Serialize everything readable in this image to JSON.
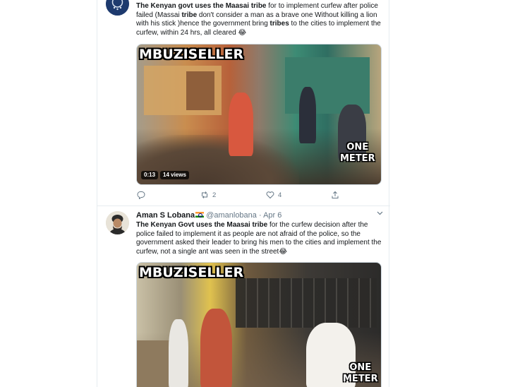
{
  "tweets": [
    {
      "text_parts": [
        {
          "t": "The Kenyan govt uses the Maasai tribe",
          "b": true
        },
        {
          "t": " for to implement curfew after police failed (Massai ",
          "b": false
        },
        {
          "t": "tribe",
          "b": true
        },
        {
          "t": " don't consider a man as a brave one Without killing a lion with his stick )hence the government bring ",
          "b": false
        },
        {
          "t": "tribes",
          "b": true
        },
        {
          "t": " to the cities to implement the curfew, within 24 hrs, all cleared 😂",
          "b": false
        }
      ],
      "media": {
        "overlay_title": "MBUZISELLER",
        "overlay_sub_line1": "ONE",
        "overlay_sub_line2": "METER",
        "duration": "0:13",
        "views": "14 views"
      },
      "actions": {
        "reply_icon": "reply-icon",
        "retweet_icon": "retweet-icon",
        "retweet_count": "2",
        "like_icon": "heart-icon",
        "like_count": "4",
        "share_icon": "share-icon"
      }
    },
    {
      "name": "Aman S Lobana",
      "flag_icon": "india-flag-icon",
      "handle": "@amanlobana",
      "dot": "·",
      "date": "Apr 6",
      "text_parts": [
        {
          "t": "The Kenyan Govt uses the Maasai tribe",
          "b": true
        },
        {
          "t": " for the curfew decision after the police failed to implement it as people are not afraid of the police, so the government asked their leader to bring his men to the cities and implement the curfew, not a single ant was seen in the street😂",
          "b": false
        }
      ],
      "media": {
        "overlay_title": "MBUZISELLER",
        "overlay_sub_line1": "ONE",
        "overlay_sub_line2": "METER"
      }
    }
  ],
  "colors": {
    "text": "#14171a",
    "muted": "#657786",
    "border": "#e6ecf0"
  }
}
